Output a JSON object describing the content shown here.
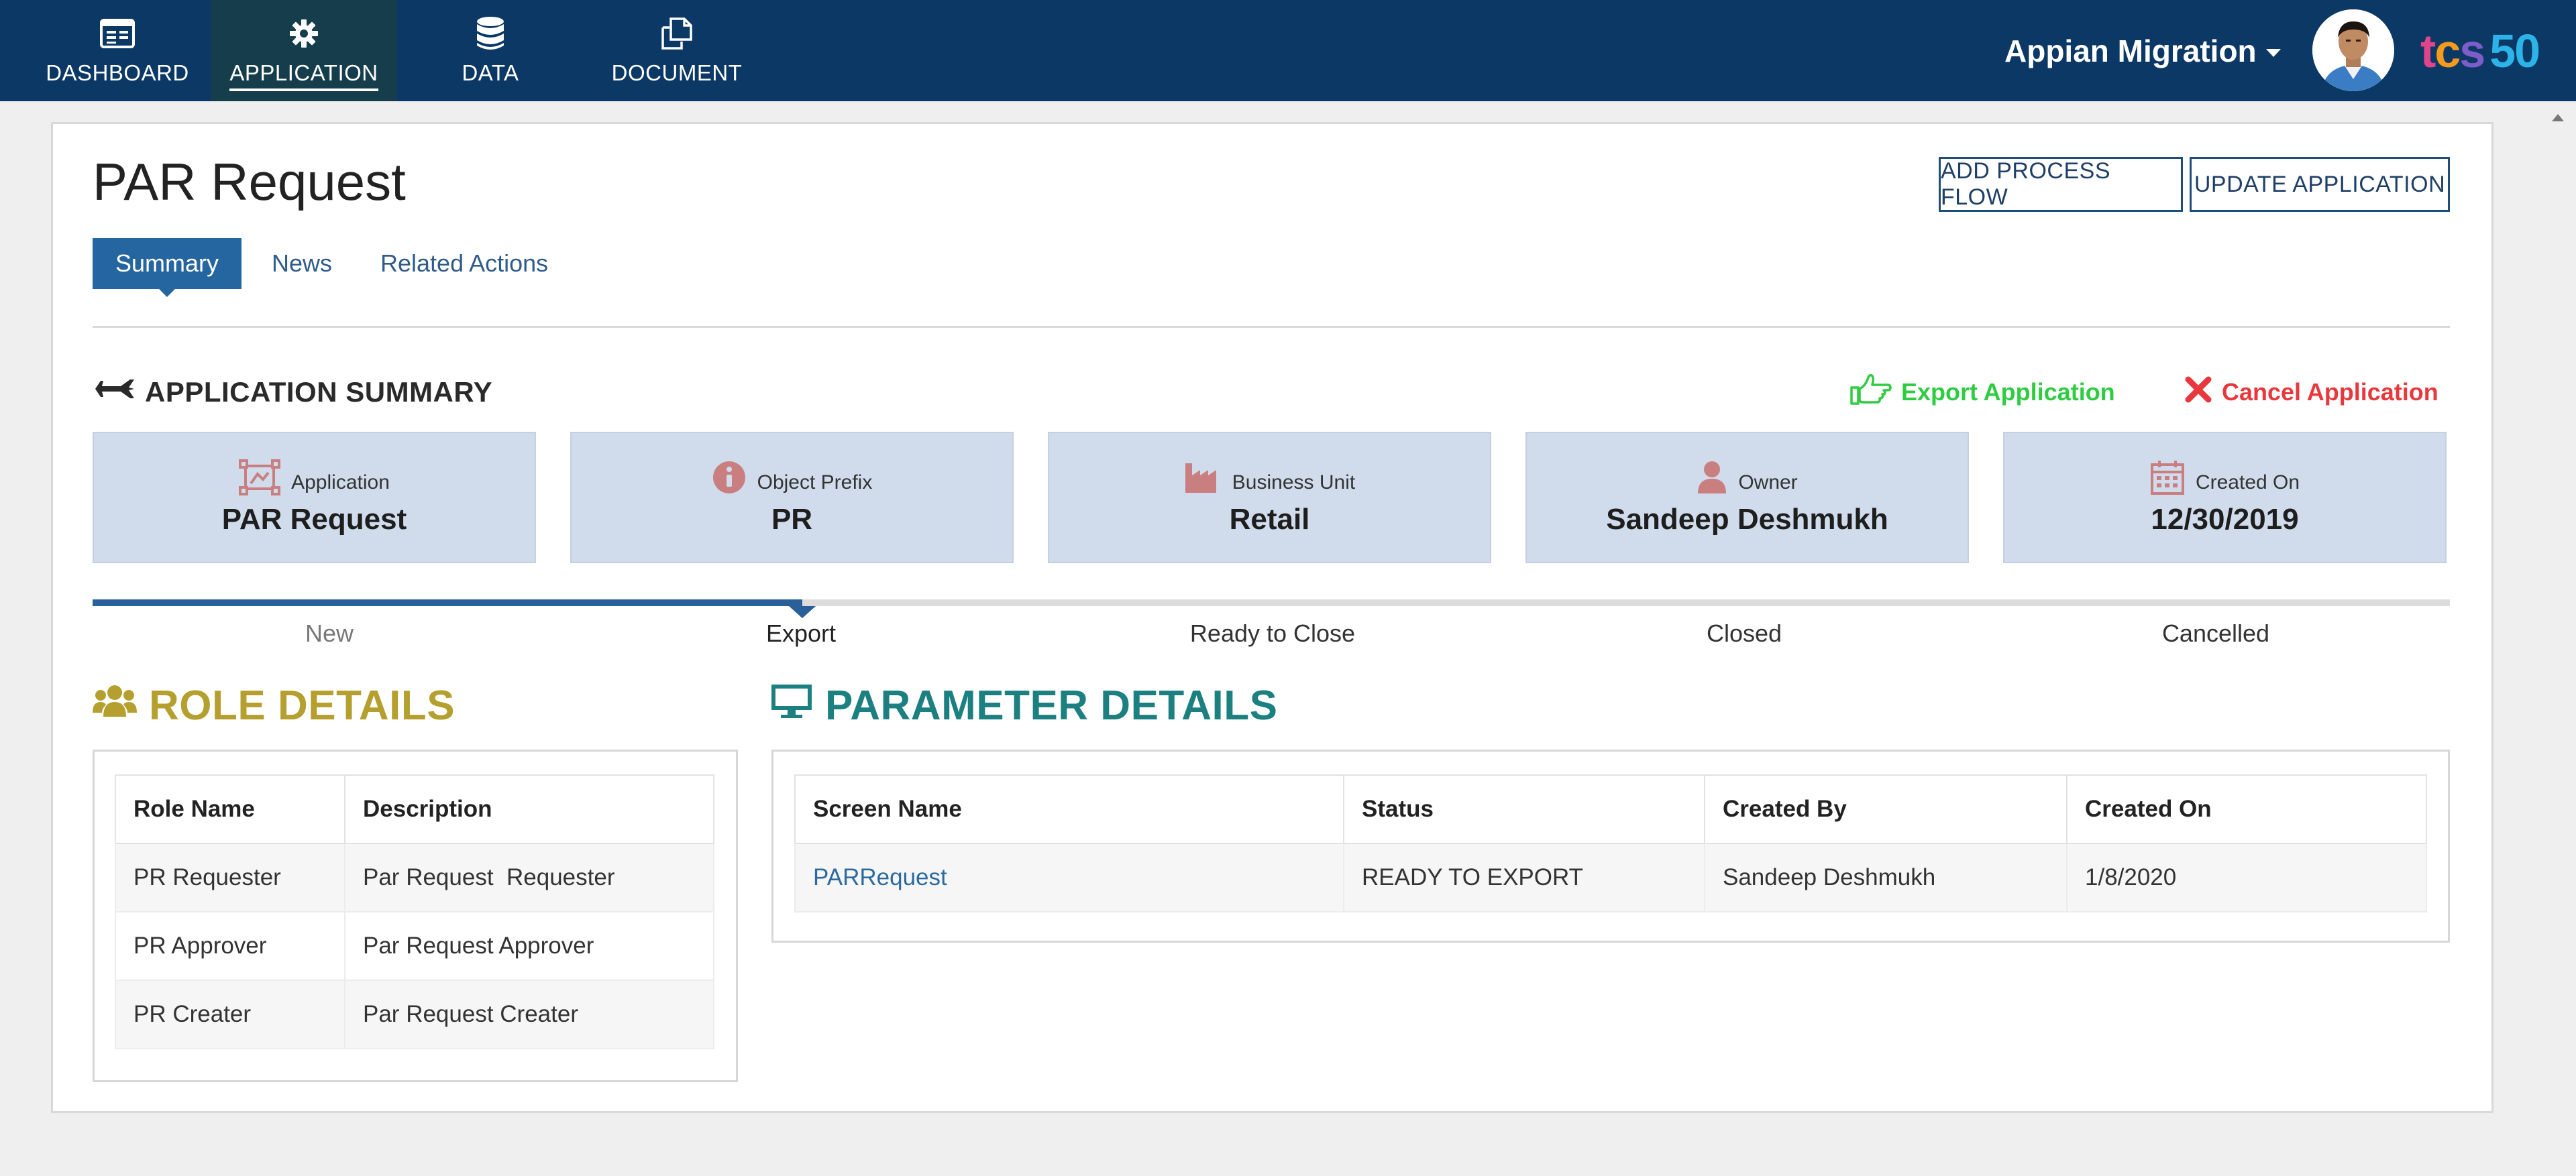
{
  "nav": {
    "items": [
      {
        "label": "DASHBOARD",
        "icon": "dashboard-icon"
      },
      {
        "label": "APPLICATION",
        "icon": "gear-icon"
      },
      {
        "label": "DATA",
        "icon": "database-icon"
      },
      {
        "label": "DOCUMENT",
        "icon": "document-icon"
      }
    ],
    "active": "APPLICATION",
    "app_switcher": "Appian Migration",
    "brand": {
      "t": "t",
      "c": "c",
      "s": "s",
      "n": "50"
    }
  },
  "page": {
    "title": "PAR Request",
    "buttons": {
      "add_process_flow": "ADD PROCESS FLOW",
      "update_application": "UPDATE APPLICATION"
    },
    "tabs": [
      {
        "label": "Summary",
        "active": true
      },
      {
        "label": "News",
        "active": false
      },
      {
        "label": "Related Actions",
        "active": false
      }
    ]
  },
  "summary": {
    "heading": "APPLICATION SUMMARY",
    "export_link": "Export Application",
    "cancel_link": "Cancel Application",
    "boxes": [
      {
        "label": "Application",
        "value": "PAR Request",
        "icon": "application-frame-icon"
      },
      {
        "label": "Object Prefix",
        "value": "PR",
        "icon": "info-icon"
      },
      {
        "label": "Business Unit",
        "value": "Retail",
        "icon": "factory-icon"
      },
      {
        "label": "Owner",
        "value": "Sandeep Deshmukh",
        "icon": "user-icon"
      },
      {
        "label": "Created On",
        "value": "12/30/2019",
        "icon": "calendar-icon"
      }
    ]
  },
  "progress": {
    "steps": [
      "New",
      "Export",
      "Ready to Close",
      "Closed",
      "Cancelled"
    ],
    "current": "Export"
  },
  "roles": {
    "heading": "ROLE DETAILS",
    "columns": [
      "Role Name",
      "Description"
    ],
    "rows": [
      [
        "PR Requester",
        "Par Request  Requester"
      ],
      [
        "PR Approver",
        "Par Request Approver"
      ],
      [
        "PR Creater",
        "Par Request Creater"
      ]
    ]
  },
  "parameters": {
    "heading": "PARAMETER DETAILS",
    "columns": [
      "Screen Name",
      "Status",
      "Created By",
      "Created On"
    ],
    "rows": [
      [
        "PARRequest",
        "READY TO EXPORT",
        "Sandeep Deshmukh",
        "1/8/2020"
      ]
    ]
  },
  "colors": {
    "nav_bg": "#0c3866",
    "nav_active_bg": "#153d4b",
    "accent_blue": "#2566a0",
    "info_box_bg": "#d0dcec",
    "export_green": "#2ecc40",
    "cancel_red": "#e8383d",
    "roles_heading": "#b5a02f",
    "params_heading": "#1d8080",
    "icon_rose": "#c97f7f"
  }
}
